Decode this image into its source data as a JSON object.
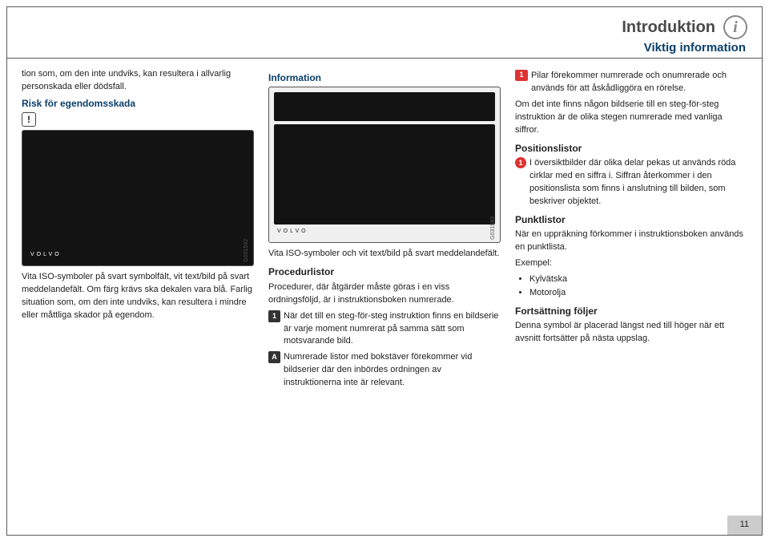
{
  "header": {
    "title": "Introduktion",
    "subhead": "Viktig information"
  },
  "col1": {
    "intro": "tion som, om den inte undviks, kan resultera i allvarlig personskada eller dödsfall.",
    "h_risk": "Risk för egendomsskada",
    "img92_brand": "VOLVO",
    "img92_id": "G031592",
    "caption1": "Vita ISO-symboler på svart symbolfält, vit text/bild på svart meddelandefält. Om färg krävs ska dekalen vara blå. Farlig situation som, om den inte undviks, kan resultera i mindre eller måttliga skador på egendom."
  },
  "col2": {
    "h_info": "Information",
    "img93_brand": "VOLVO",
    "img93_id": "G031593",
    "caption2": "Vita ISO-symboler och vit text/bild på svart meddelandefält.",
    "h_proc": "Procedurlistor",
    "proc_body": "Procedurer, där åtgärder måste göras i en viss ordningsföljd, är i instruktionsboken numrerade.",
    "step1_num": "1",
    "step1": "När det till en steg-för-steg instruktion finns en bildserie är varje moment numrerat på samma sätt som motsvarande bild.",
    "stepA_lbl": "A",
    "stepA": "Numrerade listor med bokstäver förekommer vid bildserier där den inbördes ordningen av instruktionerna inte är relevant."
  },
  "col3": {
    "pilar_lbl": "1",
    "pilar": "Pilar förekommer numrerade och onumrerade och används för att åskådliggöra en rörelse.",
    "pilar_more": "Om det inte finns någon bildserie till en steg-för-steg instruktion är de olika stegen numrerade med vanliga siffror.",
    "h_pos": "Positionslistor",
    "pos_num": "1",
    "pos": "I översiktbilder där olika delar pekas ut används röda cirklar med en siffra i. Siffran återkommer i den positionslista som finns i anslutning till bilden, som beskriver objektet.",
    "h_punkt": "Punktlistor",
    "punkt_body": "När en uppräkning förkommer i instruktionsboken används en punktlista.",
    "ex_label": "Exempel:",
    "bullets": [
      "Kylvätska",
      "Motorolja"
    ],
    "h_fort": "Fortsättning följer",
    "fort_body": "Denna symbol är placerad längst ned till höger när ett avsnitt fortsätter på nästa uppslag."
  },
  "pagenum": "11"
}
